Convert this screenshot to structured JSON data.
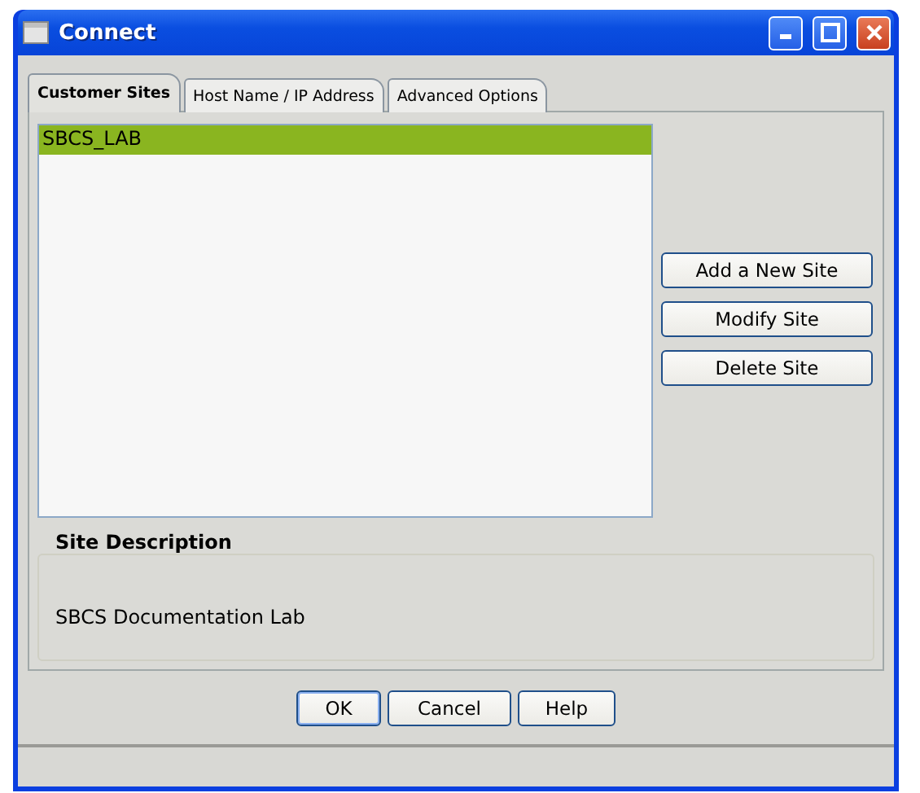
{
  "window": {
    "title": "Connect"
  },
  "tabs": [
    {
      "label": "Customer Sites",
      "selected": true
    },
    {
      "label": "Host Name / IP Address",
      "selected": false
    },
    {
      "label": "Advanced Options",
      "selected": false
    }
  ],
  "sites": [
    {
      "name": "SBCS_LAB",
      "selected": true
    }
  ],
  "site_buttons": [
    "Add a New Site",
    "Modify Site",
    "Delete Site"
  ],
  "site_description": {
    "title": "Site Description",
    "text": "SBCS Documentation Lab"
  },
  "buttons": [
    {
      "label": "OK",
      "default": true
    },
    {
      "label": "Cancel",
      "default": false
    },
    {
      "label": "Help",
      "default": false
    }
  ]
}
